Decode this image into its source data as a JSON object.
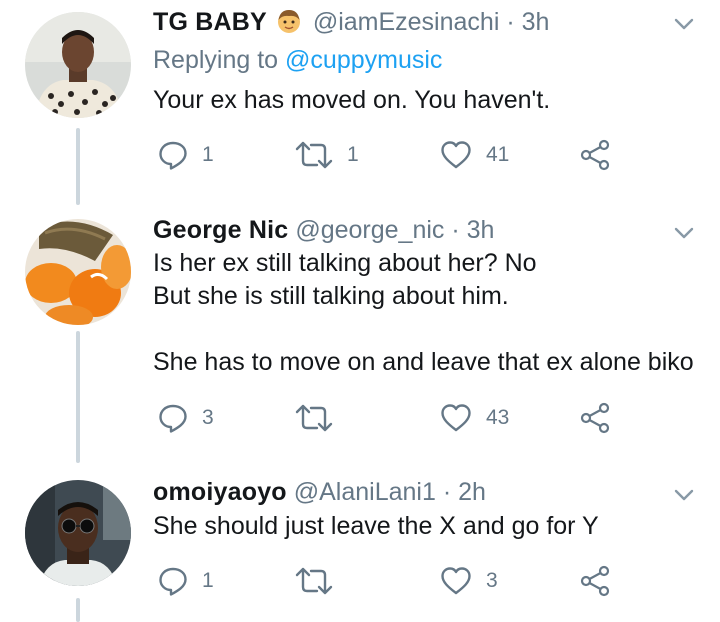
{
  "tweets": [
    {
      "display_name": "TG BABY",
      "badge_icon": "boy-face-emoji",
      "handle": "@iamEzesinachi",
      "separator": "·",
      "time": "3h",
      "replying_label": "Replying to",
      "replying_handle": "@cuppymusic",
      "text": "Your ex has moved on. You haven't.",
      "reply_count": "1",
      "retweet_count": "1",
      "like_count": "41"
    },
    {
      "display_name": "George Nic",
      "handle": "@george_nic",
      "separator": "·",
      "time": "3h",
      "text": "Is her ex still talking about her? No\nBut she is still talking about him.\n\nShe has to move on and leave that ex alone biko",
      "reply_count": "3",
      "retweet_count": "",
      "like_count": "43"
    },
    {
      "display_name": "omoiyaoyo",
      "handle": "@AlaniLani1",
      "separator": "·",
      "time": "2h",
      "text": "She should just leave the X and go for Y",
      "reply_count": "1",
      "retweet_count": "",
      "like_count": "3"
    }
  ],
  "colors": {
    "text": "#14171a",
    "secondary": "#657786",
    "link": "#1da1f2",
    "thread_line": "#ccd6dd"
  }
}
